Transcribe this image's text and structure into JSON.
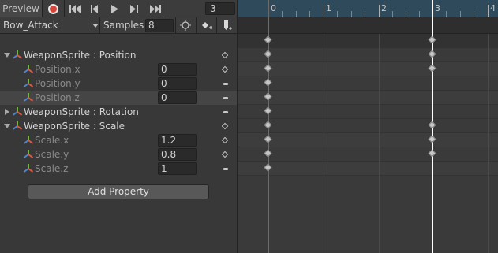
{
  "toolbar": {
    "preview_label": "Preview",
    "record_icon": "record-icon",
    "current_frame": "3"
  },
  "clip": {
    "name": "Bow_Attack",
    "samples_label": "Samples",
    "samples_value": "8"
  },
  "properties": [
    {
      "label": "WeaponSprite : Position",
      "type": "group",
      "expanded": true
    },
    {
      "label": "Position.x",
      "type": "child",
      "value": "0"
    },
    {
      "label": "Position.y",
      "type": "child",
      "value": "0"
    },
    {
      "label": "Position.z",
      "type": "child",
      "value": "0"
    },
    {
      "label": "WeaponSprite : Rotation",
      "type": "group",
      "expanded": false
    },
    {
      "label": "WeaponSprite : Scale",
      "type": "group",
      "expanded": true
    },
    {
      "label": "Scale.x",
      "type": "child",
      "value": "1.2"
    },
    {
      "label": "Scale.y",
      "type": "child",
      "value": "0.8"
    },
    {
      "label": "Scale.z",
      "type": "child",
      "value": "1"
    }
  ],
  "add_property_label": "Add Property",
  "timeline": {
    "ticks": [
      "0",
      "1",
      "2",
      "3",
      "4"
    ],
    "colors": {
      "ruler": "#2f4a5a",
      "playhead": "#ffffff",
      "record": "#d64538"
    }
  }
}
